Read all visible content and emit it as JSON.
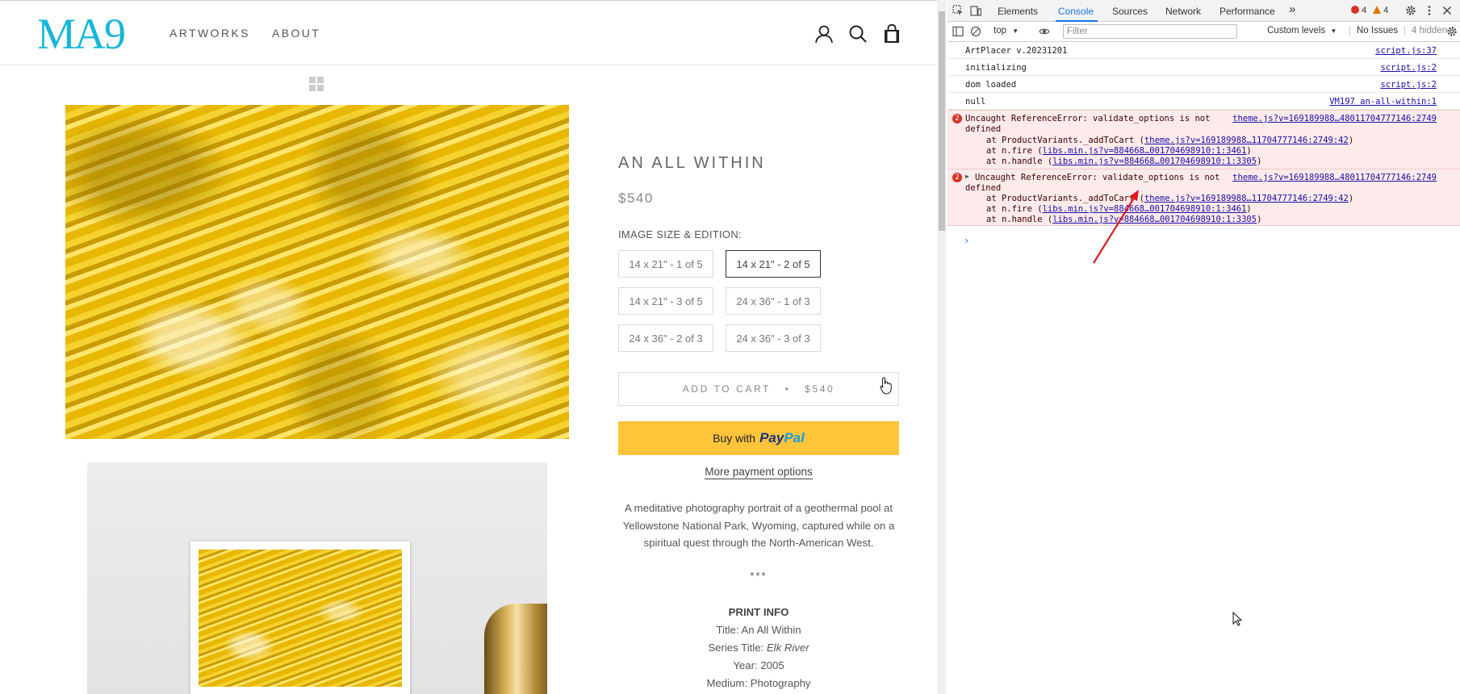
{
  "site": {
    "logo": "MA9",
    "nav": {
      "artworks": "ARTWORKS",
      "about": "ABOUT"
    }
  },
  "product": {
    "title": "AN ALL WITHIN",
    "price": "$540",
    "size_label": "IMAGE SIZE & EDITION:",
    "options": [
      {
        "label": "14 x 21\" - 1 of 5",
        "selected": false
      },
      {
        "label": "14 x 21\" - 2 of 5",
        "selected": true
      },
      {
        "label": "14 x 21\" - 3 of 5",
        "selected": false
      },
      {
        "label": "24 x 36\" - 1 of 3",
        "selected": false
      },
      {
        "label": "24 x 36\" - 2 of 3",
        "selected": false
      },
      {
        "label": "24 x 36\" - 3 of 3",
        "selected": false
      }
    ],
    "add_to_cart": "ADD TO CART   •   $540",
    "paypal_prefix": "Buy with",
    "paypal_logo_a": "Pay",
    "paypal_logo_b": "Pal",
    "more_payment": "More payment options",
    "description": "A meditative photography portrait of a geothermal pool at Yellowstone National Park, Wyoming, captured while on a spiritual quest through the North-American West.",
    "stars": "***",
    "print_info": {
      "heading": "PRINT INFO",
      "title_label": "Title: ",
      "title_value": "An All Within",
      "series_label": "Series Title: ",
      "series_value": "Elk River",
      "year": "Year: 2005",
      "medium": "Medium: Photography"
    }
  },
  "devtools": {
    "tabs": [
      "Elements",
      "Console",
      "Sources",
      "Network",
      "Performance"
    ],
    "active_tab": "Console",
    "more_tabs": "»",
    "errors_count": "4",
    "warnings_count": "4",
    "context": "top",
    "filter_placeholder": "Filter",
    "levels": "Custom levels",
    "issues": "No Issues",
    "hidden": "4 hidden",
    "logs": [
      {
        "text": "ArtPlacer v.20231201",
        "src": "script.js:37"
      },
      {
        "text": "initializing",
        "src": "script.js:2"
      },
      {
        "text": "dom loaded",
        "src": "script.js:2"
      },
      {
        "text": "null",
        "src": "VM197 an-all-within:1"
      }
    ],
    "errors": [
      {
        "badge": "2",
        "expander": "",
        "msg1": "Uncaught ReferenceError: validate_options is not",
        "msg2": "defined",
        "src": "theme.js?v=169189988…48011704777146:2749",
        "stack": [
          {
            "prefix": "at ProductVariants._addToCart (",
            "link": "theme.js?v=169189988…11704777146:2749:42",
            "suffix": ")"
          },
          {
            "prefix": "at n.fire (",
            "link": "libs.min.js?v=884668…001704698910:1:3461",
            "suffix": ")"
          },
          {
            "prefix": "at n.handle (",
            "link": "libs.min.js?v=884668…001704698910:1:3305",
            "suffix": ")"
          }
        ]
      },
      {
        "badge": "2",
        "expander": "▶",
        "msg1": "Uncaught ReferenceError: validate_options is not",
        "msg2": "defined",
        "src": "theme.js?v=169189988…48011704777146:2749",
        "stack": [
          {
            "prefix": "at ProductVariants._addToCart (",
            "link": "theme.js?v=169189988…11704777146:2749:42",
            "suffix": ")"
          },
          {
            "prefix": "at n.fire (",
            "link": "libs.min.js?v=884668…001704698910:1:3461",
            "suffix": ")"
          },
          {
            "prefix": "at n.handle (",
            "link": "libs.min.js?v=884668…001704698910:1:3305",
            "suffix": ")"
          }
        ]
      }
    ],
    "prompt": "›"
  },
  "colors": {
    "brand": "#16b7d9",
    "paypal": "#ffc43a",
    "devtools_accent": "#1a73e8",
    "error_bg": "#fdeaea",
    "annotation": "#e0191c"
  }
}
